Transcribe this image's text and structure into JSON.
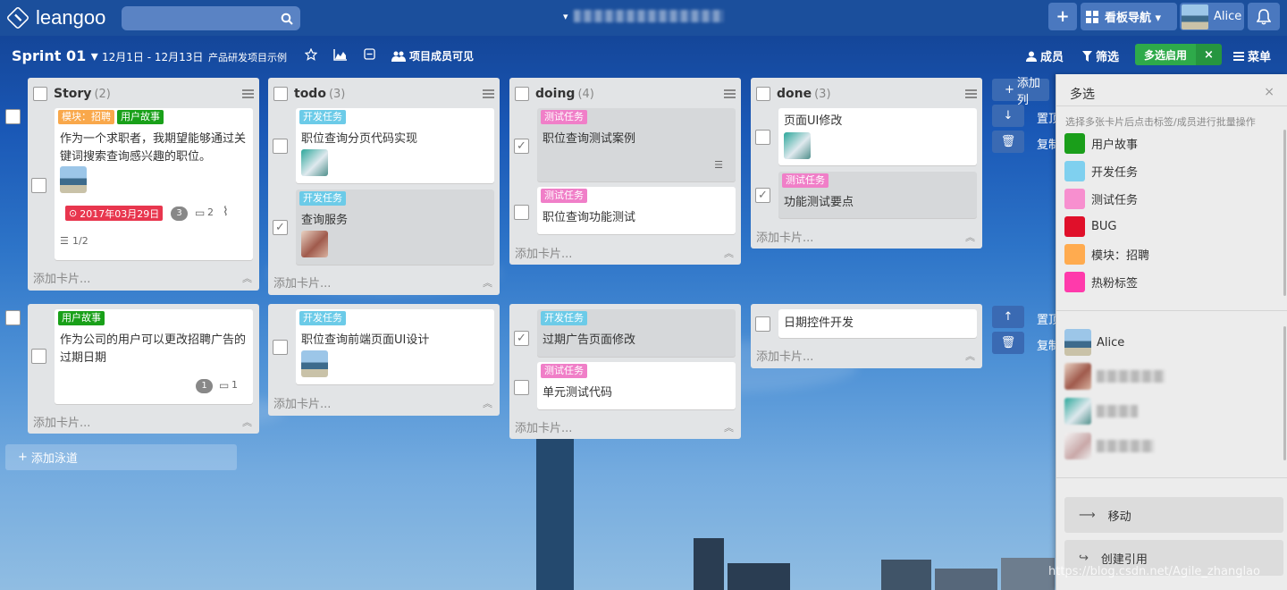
{
  "app": {
    "name": "leangoo",
    "board_menu_arrow": "▾"
  },
  "topbar": {
    "add_label": "+",
    "nav_label": "看板导航 ▾",
    "user_name": "Alice"
  },
  "sprint": {
    "title": "Sprint 01 ▾",
    "dates": "12月1日 - 12月13日",
    "project": "产品研发项目示例",
    "visibility": "项目成员可见"
  },
  "actions": {
    "members": "成员",
    "filter": "筛选",
    "multi": "多选启用",
    "multi_close": "×",
    "menu": "菜单"
  },
  "add_card": "添加卡片...",
  "lists": [
    {
      "title": "Story",
      "count": "(2)"
    },
    {
      "title": "todo",
      "count": "(3)"
    },
    {
      "title": "doing",
      "count": "(4)"
    },
    {
      "title": "done",
      "count": "(3)"
    }
  ],
  "cards": {
    "c1": {
      "labels": [
        "模块：招聘",
        "用户故事"
      ],
      "text": "作为一个求职者，我期望能够通过关键词搜索查询感兴趣的职位。",
      "due": "2017年03月29日",
      "badge": "3",
      "comments": "2",
      "checklist": "1/2"
    },
    "c2": {
      "label": "开发任务",
      "text": "职位查询分页代码实现"
    },
    "c3": {
      "label": "开发任务",
      "text": "查询服务"
    },
    "c4": {
      "label": "测试任务",
      "text": "职位查询测试案例"
    },
    "c5": {
      "label": "测试任务",
      "text": "职位查询功能测试"
    },
    "c6": {
      "text": "页面UI修改"
    },
    "c7": {
      "label": "测试任务",
      "text": "功能测试要点"
    },
    "c8": {
      "label": "用户故事",
      "text": "作为公司的用户可以更改招聘广告的过期日期",
      "badge": "1",
      "comments": "1"
    },
    "c9": {
      "label": "开发任务",
      "text": "职位查询前端页面UI设计"
    },
    "c10": {
      "label": "开发任务",
      "text": "过期广告页面修改"
    },
    "c11": {
      "label": "测试任务",
      "text": "单元测试代码"
    },
    "c12": {
      "text": "日期控件开发"
    }
  },
  "side": {
    "add_list": "添加列",
    "pin": "置顶",
    "copy": "复制"
  },
  "add_lane": "添加泳道",
  "panel": {
    "title": "多选",
    "close": "×",
    "hint": "选择多张卡片后点击标签/成员进行批量操作",
    "labels": [
      {
        "name": "用户故事",
        "color": "#1a9e1a"
      },
      {
        "name": "开发任务",
        "color": "#7fd0ef"
      },
      {
        "name": "测试任务",
        "color": "#f78fcf"
      },
      {
        "name": "BUG",
        "color": "#e0102a"
      },
      {
        "name": "模块：招聘",
        "color": "#ffab4f"
      },
      {
        "name": "热粉标签",
        "color": "#ff3aab"
      }
    ],
    "members": [
      "Alice"
    ],
    "move": "移动",
    "reference": "创建引用"
  },
  "colors": {
    "dev": "#6ccbe8",
    "test": "#f07fc8",
    "story": "#19a019",
    "module": "#f9a84b",
    "due": "#e8364e"
  },
  "watermark": "https://blog.csdn.net/Agile_zhanglao"
}
